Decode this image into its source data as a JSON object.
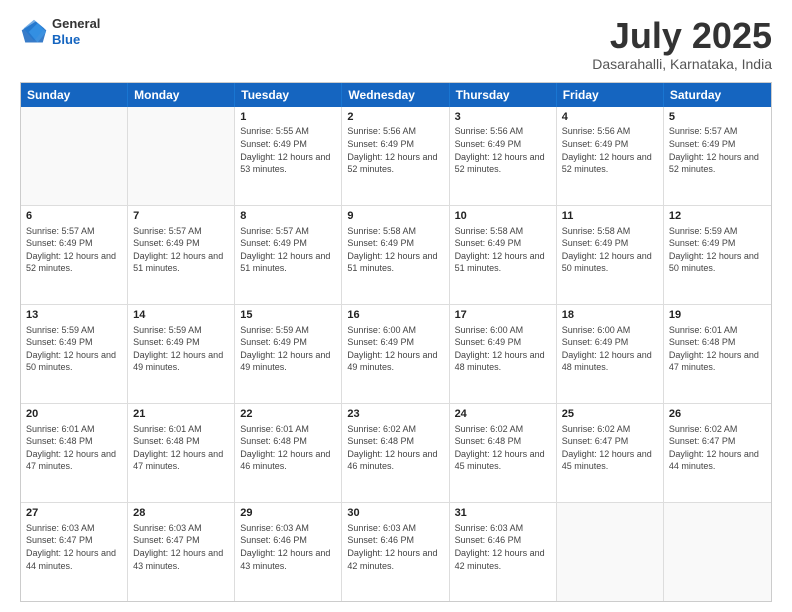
{
  "logo": {
    "general": "General",
    "blue": "Blue"
  },
  "title": "July 2025",
  "subtitle": "Dasarahalli, Karnataka, India",
  "weekdays": [
    "Sunday",
    "Monday",
    "Tuesday",
    "Wednesday",
    "Thursday",
    "Friday",
    "Saturday"
  ],
  "weeks": [
    [
      {
        "day": "",
        "info": ""
      },
      {
        "day": "",
        "info": ""
      },
      {
        "day": "1",
        "info": "Sunrise: 5:55 AM\nSunset: 6:49 PM\nDaylight: 12 hours and 53 minutes."
      },
      {
        "day": "2",
        "info": "Sunrise: 5:56 AM\nSunset: 6:49 PM\nDaylight: 12 hours and 52 minutes."
      },
      {
        "day": "3",
        "info": "Sunrise: 5:56 AM\nSunset: 6:49 PM\nDaylight: 12 hours and 52 minutes."
      },
      {
        "day": "4",
        "info": "Sunrise: 5:56 AM\nSunset: 6:49 PM\nDaylight: 12 hours and 52 minutes."
      },
      {
        "day": "5",
        "info": "Sunrise: 5:57 AM\nSunset: 6:49 PM\nDaylight: 12 hours and 52 minutes."
      }
    ],
    [
      {
        "day": "6",
        "info": "Sunrise: 5:57 AM\nSunset: 6:49 PM\nDaylight: 12 hours and 52 minutes."
      },
      {
        "day": "7",
        "info": "Sunrise: 5:57 AM\nSunset: 6:49 PM\nDaylight: 12 hours and 51 minutes."
      },
      {
        "day": "8",
        "info": "Sunrise: 5:57 AM\nSunset: 6:49 PM\nDaylight: 12 hours and 51 minutes."
      },
      {
        "day": "9",
        "info": "Sunrise: 5:58 AM\nSunset: 6:49 PM\nDaylight: 12 hours and 51 minutes."
      },
      {
        "day": "10",
        "info": "Sunrise: 5:58 AM\nSunset: 6:49 PM\nDaylight: 12 hours and 51 minutes."
      },
      {
        "day": "11",
        "info": "Sunrise: 5:58 AM\nSunset: 6:49 PM\nDaylight: 12 hours and 50 minutes."
      },
      {
        "day": "12",
        "info": "Sunrise: 5:59 AM\nSunset: 6:49 PM\nDaylight: 12 hours and 50 minutes."
      }
    ],
    [
      {
        "day": "13",
        "info": "Sunrise: 5:59 AM\nSunset: 6:49 PM\nDaylight: 12 hours and 50 minutes."
      },
      {
        "day": "14",
        "info": "Sunrise: 5:59 AM\nSunset: 6:49 PM\nDaylight: 12 hours and 49 minutes."
      },
      {
        "day": "15",
        "info": "Sunrise: 5:59 AM\nSunset: 6:49 PM\nDaylight: 12 hours and 49 minutes."
      },
      {
        "day": "16",
        "info": "Sunrise: 6:00 AM\nSunset: 6:49 PM\nDaylight: 12 hours and 49 minutes."
      },
      {
        "day": "17",
        "info": "Sunrise: 6:00 AM\nSunset: 6:49 PM\nDaylight: 12 hours and 48 minutes."
      },
      {
        "day": "18",
        "info": "Sunrise: 6:00 AM\nSunset: 6:49 PM\nDaylight: 12 hours and 48 minutes."
      },
      {
        "day": "19",
        "info": "Sunrise: 6:01 AM\nSunset: 6:48 PM\nDaylight: 12 hours and 47 minutes."
      }
    ],
    [
      {
        "day": "20",
        "info": "Sunrise: 6:01 AM\nSunset: 6:48 PM\nDaylight: 12 hours and 47 minutes."
      },
      {
        "day": "21",
        "info": "Sunrise: 6:01 AM\nSunset: 6:48 PM\nDaylight: 12 hours and 47 minutes."
      },
      {
        "day": "22",
        "info": "Sunrise: 6:01 AM\nSunset: 6:48 PM\nDaylight: 12 hours and 46 minutes."
      },
      {
        "day": "23",
        "info": "Sunrise: 6:02 AM\nSunset: 6:48 PM\nDaylight: 12 hours and 46 minutes."
      },
      {
        "day": "24",
        "info": "Sunrise: 6:02 AM\nSunset: 6:48 PM\nDaylight: 12 hours and 45 minutes."
      },
      {
        "day": "25",
        "info": "Sunrise: 6:02 AM\nSunset: 6:47 PM\nDaylight: 12 hours and 45 minutes."
      },
      {
        "day": "26",
        "info": "Sunrise: 6:02 AM\nSunset: 6:47 PM\nDaylight: 12 hours and 44 minutes."
      }
    ],
    [
      {
        "day": "27",
        "info": "Sunrise: 6:03 AM\nSunset: 6:47 PM\nDaylight: 12 hours and 44 minutes."
      },
      {
        "day": "28",
        "info": "Sunrise: 6:03 AM\nSunset: 6:47 PM\nDaylight: 12 hours and 43 minutes."
      },
      {
        "day": "29",
        "info": "Sunrise: 6:03 AM\nSunset: 6:46 PM\nDaylight: 12 hours and 43 minutes."
      },
      {
        "day": "30",
        "info": "Sunrise: 6:03 AM\nSunset: 6:46 PM\nDaylight: 12 hours and 42 minutes."
      },
      {
        "day": "31",
        "info": "Sunrise: 6:03 AM\nSunset: 6:46 PM\nDaylight: 12 hours and 42 minutes."
      },
      {
        "day": "",
        "info": ""
      },
      {
        "day": "",
        "info": ""
      }
    ]
  ]
}
